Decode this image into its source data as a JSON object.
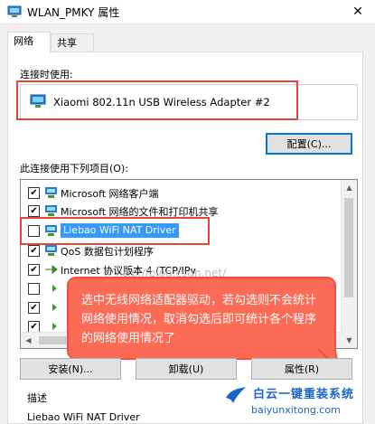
{
  "window": {
    "title": "WLAN_PMKY 属性",
    "close_glyph": "✕"
  },
  "tabs": [
    {
      "label": "网络"
    },
    {
      "label": "共享"
    }
  ],
  "connect_using": {
    "label": "连接时使用:",
    "adapter_name": "Xiaomi 802.11n USB Wireless Adapter #2",
    "configure_button": "配置(C)..."
  },
  "items_list": {
    "label": "此连接使用下列项目(O):",
    "items": [
      {
        "label": "Microsoft 网络客户端",
        "checked": true
      },
      {
        "label": "Microsoft 网络的文件和打印机共享",
        "checked": true
      },
      {
        "label": "Liebao WiFi NAT Driver",
        "checked": false
      },
      {
        "label": "QoS 数据包计划程序",
        "checked": true
      },
      {
        "label": "Internet 协议版本 4 (TCP/IPv",
        "checked": true
      },
      {
        "label": "",
        "checked": false
      },
      {
        "label": "",
        "checked": true
      },
      {
        "label": "",
        "checked": true
      }
    ]
  },
  "buttons": {
    "install": "安装(N)...",
    "uninstall": "卸载(U)",
    "properties": "属性(R)"
  },
  "description": {
    "title": "描述",
    "text": "Liebao WiFi NAT Driver"
  },
  "callout": {
    "text": "选中无线网络适配器驱动，若勾选则不会统计网络使用情况，取消勾选后即可统计各个程序的网络使用情况了"
  },
  "watermark": {
    "text": "http://blog.csdn.net/"
  },
  "brand": {
    "name": "白云一键重装系统",
    "url": "baiyunxitong.com"
  },
  "colors": {
    "highlight": "#e8443a",
    "callout_fill": "#fc6b55",
    "brand_blue": "#1a66c8"
  }
}
